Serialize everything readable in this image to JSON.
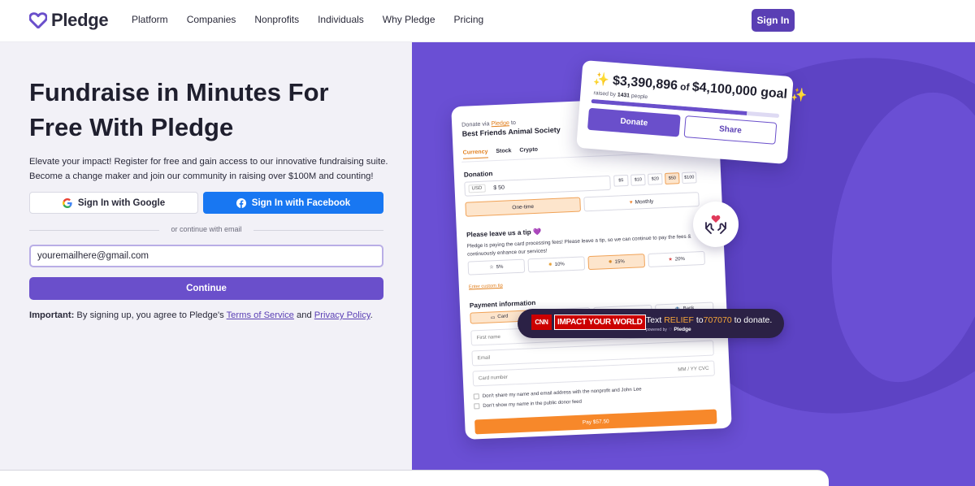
{
  "nav": {
    "brand": "Pledge",
    "links": [
      "Platform",
      "Companies",
      "Nonprofits",
      "Individuals",
      "Why Pledge",
      "Pricing"
    ],
    "sign_in": "Sign In"
  },
  "hero": {
    "title_line1": "Fundraise in Minutes For",
    "title_line2": "Free With Pledge",
    "subtitle_line1": "Elevate your impact! Register for free and gain access to our innovative fundraising suite.",
    "subtitle_line2": "Become a change maker and join our community in raising over $100M and counting!",
    "google_button": "Sign In with Google",
    "facebook_button": "Sign In with Facebook",
    "divider_text": "or continue with email",
    "email_value": "youremailhere@gmail.com",
    "continue_button": "Continue",
    "terms_prefix": "Important:",
    "terms_text": " By signing up, you agree to Pledge's ",
    "terms_link": "Terms of Service",
    "terms_and": " and ",
    "privacy_link": "Privacy Policy",
    "terms_end": "."
  },
  "progress_card": {
    "sparkle": "✨",
    "raised": "$3,390,896",
    "of_text": " of ",
    "goal": "$4,100,000 goal",
    "raised_by_prefix": "raised by ",
    "donor_count": "1431",
    "raised_by_suffix": " people",
    "progress_fraction": 0.827,
    "donate": "Donate",
    "share": "Share"
  },
  "donation_form": {
    "donate_via": "Donate via ",
    "platform_link": "Pledge",
    "donate_to": " to",
    "org_name": "Best Friends Animal Society",
    "tabs": [
      "Currency",
      "Stock",
      "Crypto"
    ],
    "donation_label": "Donation",
    "currency": "USD",
    "amount": "$ 50",
    "presets": [
      "$5",
      "$10",
      "$20",
      "$50",
      "$100"
    ],
    "frequency": [
      "One-time",
      "Monthly"
    ],
    "tip_heading": "Please leave us a tip 💜",
    "tip_description": "Pledge is paying the card processing fees! Please leave a tip, so we can continue to pay the fees & continuously enhance our services!",
    "tips": [
      "5%",
      "10%",
      "15%",
      "20%"
    ],
    "custom_tip": "Enter custom tip",
    "payment_heading": "Payment information",
    "payment_methods": [
      "Card",
      "",
      "",
      "Bank"
    ],
    "first_name": "First name",
    "email": "Email",
    "card_number": "Card number",
    "card_meta": "MM / YY  CVC",
    "check_share": "Don't share my name and email address with the nonprofit and John Lee",
    "check_public": "Don't show my name in the public donor feed",
    "pay_button": "Pay $57.50"
  },
  "cnn_badge": {
    "cnn": "CNN",
    "impact": "IMPACT YOUR WORLD",
    "text_pre": "Text ",
    "keyword": "RELIEF",
    "to": " to",
    "number": "707070",
    "text_post": " to donate.",
    "powered_by": "powered by",
    "brand": "Pledge"
  },
  "colors": {
    "brand_purple": "#6a4fcb",
    "panel_purple": "#6a4fd4",
    "facebook_blue": "#1877f2",
    "accent_orange": "#f7882a"
  }
}
